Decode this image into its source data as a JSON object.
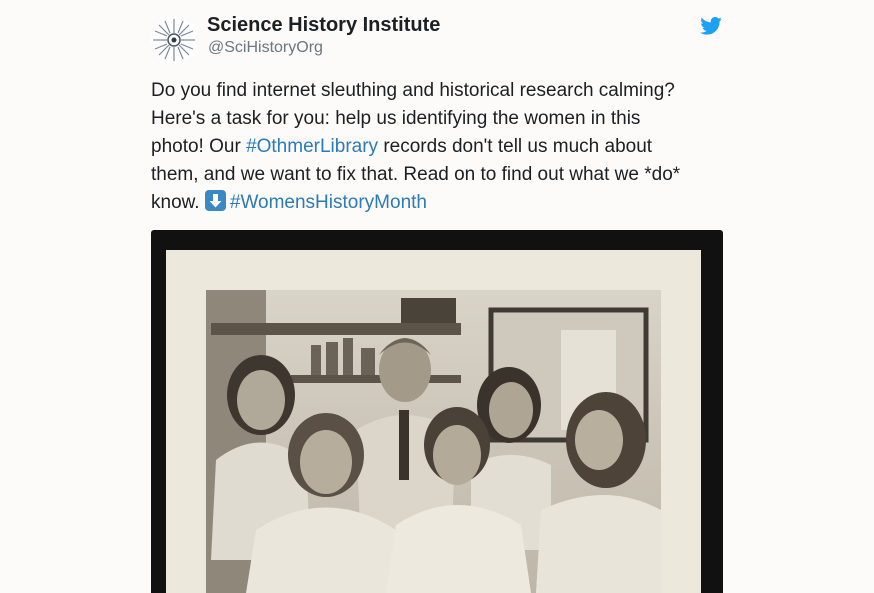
{
  "account": {
    "name": "Science History Institute",
    "handle": "@SciHistoryOrg",
    "avatar_icon": "starburst-logo-icon"
  },
  "twitter_icon": "twitter-bird-icon",
  "tweet": {
    "line1": "Do you find internet sleuthing and historical research calming?",
    "line2": "Here's a task for you: help us identifying the women in this",
    "line3_pre": "photo! Our ",
    "line3_hashtag": "#OthmerLibrary",
    "line3_post": " records don't tell us much about",
    "line4": "them, and we want to fix that. Read on to find out what we *do*",
    "line5_pre": "know. ",
    "line5_emoji": "down-arrow-emoji-icon",
    "line5_hashtag": "#WomensHistoryMonth"
  },
  "colors": {
    "hashtag": "#2b7bb9",
    "twitter_blue": "#1da1f2",
    "text": "#1c2022",
    "handle": "#697882"
  }
}
